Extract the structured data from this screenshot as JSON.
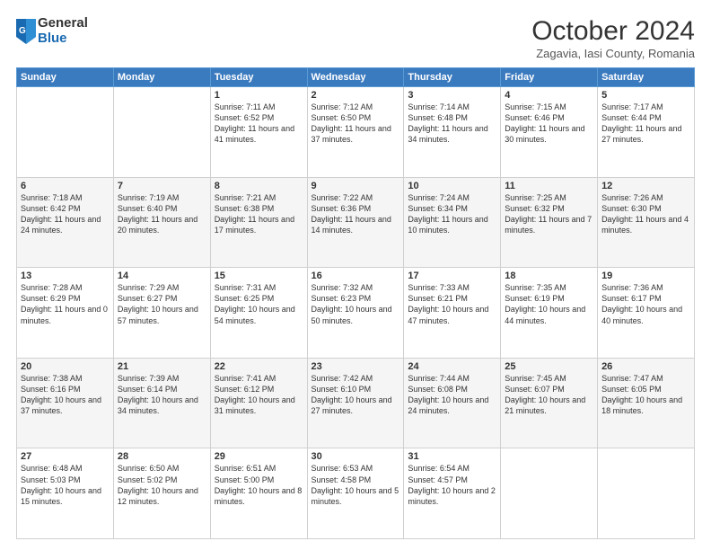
{
  "logo": {
    "general": "General",
    "blue": "Blue"
  },
  "title": "October 2024",
  "location": "Zagavia, Iasi County, Romania",
  "days_of_week": [
    "Sunday",
    "Monday",
    "Tuesday",
    "Wednesday",
    "Thursday",
    "Friday",
    "Saturday"
  ],
  "weeks": [
    [
      {
        "day": null
      },
      {
        "day": null
      },
      {
        "day": "1",
        "sunrise": "7:11 AM",
        "sunset": "6:52 PM",
        "daylight": "11 hours and 41 minutes."
      },
      {
        "day": "2",
        "sunrise": "7:12 AM",
        "sunset": "6:50 PM",
        "daylight": "11 hours and 37 minutes."
      },
      {
        "day": "3",
        "sunrise": "7:14 AM",
        "sunset": "6:48 PM",
        "daylight": "11 hours and 34 minutes."
      },
      {
        "day": "4",
        "sunrise": "7:15 AM",
        "sunset": "6:46 PM",
        "daylight": "11 hours and 30 minutes."
      },
      {
        "day": "5",
        "sunrise": "7:17 AM",
        "sunset": "6:44 PM",
        "daylight": "11 hours and 27 minutes."
      }
    ],
    [
      {
        "day": "6",
        "sunrise": "7:18 AM",
        "sunset": "6:42 PM",
        "daylight": "11 hours and 24 minutes."
      },
      {
        "day": "7",
        "sunrise": "7:19 AM",
        "sunset": "6:40 PM",
        "daylight": "11 hours and 20 minutes."
      },
      {
        "day": "8",
        "sunrise": "7:21 AM",
        "sunset": "6:38 PM",
        "daylight": "11 hours and 17 minutes."
      },
      {
        "day": "9",
        "sunrise": "7:22 AM",
        "sunset": "6:36 PM",
        "daylight": "11 hours and 14 minutes."
      },
      {
        "day": "10",
        "sunrise": "7:24 AM",
        "sunset": "6:34 PM",
        "daylight": "11 hours and 10 minutes."
      },
      {
        "day": "11",
        "sunrise": "7:25 AM",
        "sunset": "6:32 PM",
        "daylight": "11 hours and 7 minutes."
      },
      {
        "day": "12",
        "sunrise": "7:26 AM",
        "sunset": "6:30 PM",
        "daylight": "11 hours and 4 minutes."
      }
    ],
    [
      {
        "day": "13",
        "sunrise": "7:28 AM",
        "sunset": "6:29 PM",
        "daylight": "11 hours and 0 minutes."
      },
      {
        "day": "14",
        "sunrise": "7:29 AM",
        "sunset": "6:27 PM",
        "daylight": "10 hours and 57 minutes."
      },
      {
        "day": "15",
        "sunrise": "7:31 AM",
        "sunset": "6:25 PM",
        "daylight": "10 hours and 54 minutes."
      },
      {
        "day": "16",
        "sunrise": "7:32 AM",
        "sunset": "6:23 PM",
        "daylight": "10 hours and 50 minutes."
      },
      {
        "day": "17",
        "sunrise": "7:33 AM",
        "sunset": "6:21 PM",
        "daylight": "10 hours and 47 minutes."
      },
      {
        "day": "18",
        "sunrise": "7:35 AM",
        "sunset": "6:19 PM",
        "daylight": "10 hours and 44 minutes."
      },
      {
        "day": "19",
        "sunrise": "7:36 AM",
        "sunset": "6:17 PM",
        "daylight": "10 hours and 40 minutes."
      }
    ],
    [
      {
        "day": "20",
        "sunrise": "7:38 AM",
        "sunset": "6:16 PM",
        "daylight": "10 hours and 37 minutes."
      },
      {
        "day": "21",
        "sunrise": "7:39 AM",
        "sunset": "6:14 PM",
        "daylight": "10 hours and 34 minutes."
      },
      {
        "day": "22",
        "sunrise": "7:41 AM",
        "sunset": "6:12 PM",
        "daylight": "10 hours and 31 minutes."
      },
      {
        "day": "23",
        "sunrise": "7:42 AM",
        "sunset": "6:10 PM",
        "daylight": "10 hours and 27 minutes."
      },
      {
        "day": "24",
        "sunrise": "7:44 AM",
        "sunset": "6:08 PM",
        "daylight": "10 hours and 24 minutes."
      },
      {
        "day": "25",
        "sunrise": "7:45 AM",
        "sunset": "6:07 PM",
        "daylight": "10 hours and 21 minutes."
      },
      {
        "day": "26",
        "sunrise": "7:47 AM",
        "sunset": "6:05 PM",
        "daylight": "10 hours and 18 minutes."
      }
    ],
    [
      {
        "day": "27",
        "sunrise": "6:48 AM",
        "sunset": "5:03 PM",
        "daylight": "10 hours and 15 minutes."
      },
      {
        "day": "28",
        "sunrise": "6:50 AM",
        "sunset": "5:02 PM",
        "daylight": "10 hours and 12 minutes."
      },
      {
        "day": "29",
        "sunrise": "6:51 AM",
        "sunset": "5:00 PM",
        "daylight": "10 hours and 8 minutes."
      },
      {
        "day": "30",
        "sunrise": "6:53 AM",
        "sunset": "4:58 PM",
        "daylight": "10 hours and 5 minutes."
      },
      {
        "day": "31",
        "sunrise": "6:54 AM",
        "sunset": "4:57 PM",
        "daylight": "10 hours and 2 minutes."
      },
      {
        "day": null
      },
      {
        "day": null
      }
    ]
  ]
}
